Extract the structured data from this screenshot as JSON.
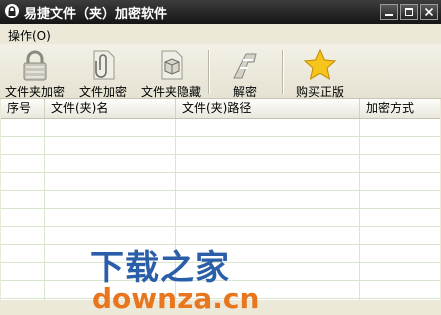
{
  "window": {
    "title": "易捷文件（夹）加密软件"
  },
  "menubar": {
    "items": [
      {
        "label": "操作(O)"
      }
    ]
  },
  "toolbar": {
    "buttons": [
      {
        "label": "文件夹加密",
        "icon": "padlock-icon"
      },
      {
        "label": "文件加密",
        "icon": "paperclip-icon"
      },
      {
        "label": "文件夹隐藏",
        "icon": "box-icon"
      },
      {
        "label": "解密",
        "icon": "key-icon"
      },
      {
        "label": "购买正版",
        "icon": "star-icon"
      }
    ]
  },
  "table": {
    "columns": [
      "序号",
      "文件(夹)名",
      "文件(夹)路径",
      "加密方式"
    ],
    "rows": []
  },
  "watermark": {
    "cn": "下载之家",
    "en": "downza.cn"
  },
  "colors": {
    "titlebar": "#1f1f1f",
    "row_line": "#d7e6cc",
    "watermark_blue": "#2a5ea8",
    "watermark_orange": "#e8761e"
  }
}
